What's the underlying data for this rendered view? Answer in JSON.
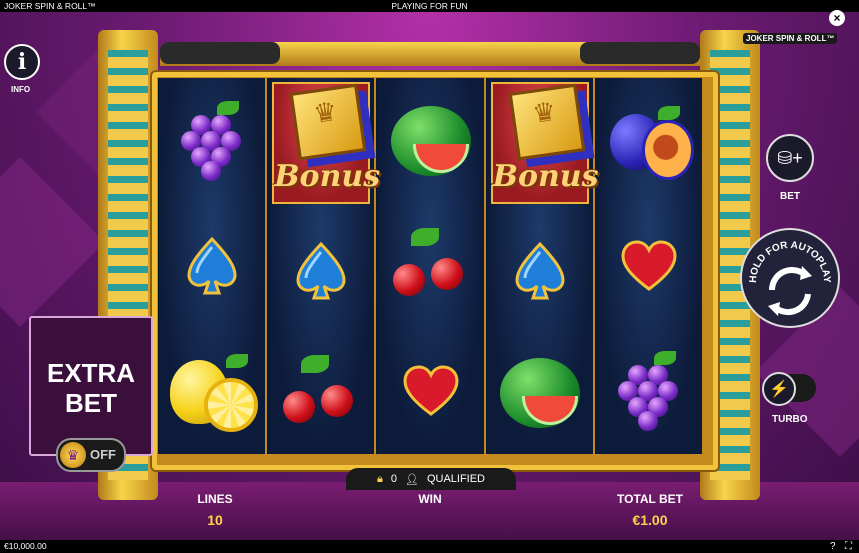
{
  "topbar": {
    "game_title": "JOKER SPIN & ROLL™",
    "mode": "PLAYING FOR FUN",
    "close": "×"
  },
  "logo": "JOKER SPIN & ROLL™",
  "info": {
    "icon": "i",
    "label": "INFO"
  },
  "extra_bet": {
    "line1": "EXTRA",
    "line2": "BET",
    "toggle_state": "OFF"
  },
  "reels": [
    [
      "grapes",
      "spade",
      "lemon"
    ],
    [
      "bonus",
      "spade",
      "cherries"
    ],
    [
      "watermelon",
      "cherries",
      "heart"
    ],
    [
      "bonus",
      "spade",
      "watermelon"
    ],
    [
      "plum",
      "heart",
      "grapes"
    ]
  ],
  "bonus_label": "Bonus",
  "controls": {
    "bet_label": "BET",
    "autoplay_text": "HOLD FOR AUTOPLAY",
    "turbo_label": "TURBO"
  },
  "qualified": {
    "count": "0",
    "label": "QUALIFIED"
  },
  "stats": {
    "lines_label": "LINES",
    "lines_value": "10",
    "win_label": "WIN",
    "total_bet_label": "TOTAL BET",
    "total_bet_value": "€1.00"
  },
  "bottombar": {
    "balance": "€10,000.00",
    "help_icon": "?"
  },
  "colors": {
    "gold": "#f3c23b",
    "accent_yellow": "#ffd24a",
    "purple_bg": "#6c1b73"
  }
}
